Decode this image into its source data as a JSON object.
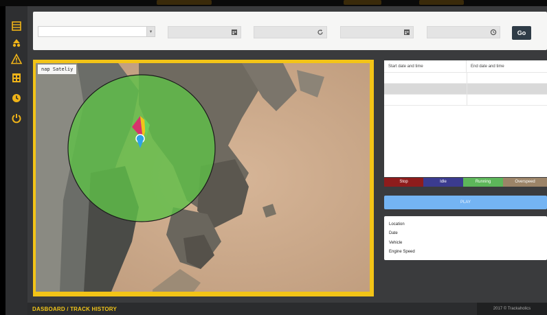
{
  "sidebar": {
    "items": [
      {
        "icon": "dashboard-grid-icon"
      },
      {
        "icon": "vehicles-icon"
      },
      {
        "icon": "alert-warning-icon"
      },
      {
        "icon": "report-calendar-icon"
      },
      {
        "icon": "history-icon"
      },
      {
        "icon": "power-logout-icon"
      }
    ]
  },
  "toolbar": {
    "vehicle_select_value": "",
    "fields": [
      {
        "icon": "calendar-icon",
        "value": ""
      },
      {
        "icon": "refresh-icon",
        "value": ""
      },
      {
        "icon": "calendar-icon",
        "value": ""
      },
      {
        "icon": "clock-icon",
        "value": ""
      }
    ],
    "go_label": "Go"
  },
  "map": {
    "label": "nap  Sateliy",
    "geofence_color": "#5fbf48",
    "marker_icon": "location-pin-icon"
  },
  "table": {
    "headers": [
      "Start date and time",
      "End date and time"
    ],
    "rows": [
      [
        "",
        ""
      ],
      [
        "",
        ""
      ],
      [
        "",
        ""
      ]
    ]
  },
  "legend": [
    {
      "label": "Stop",
      "color": "#8e1c1c"
    },
    {
      "label": "Idle",
      "color": "#3b3b8f"
    },
    {
      "label": "Running",
      "color": "#5db65a"
    },
    {
      "label": "Overspeed",
      "color": "#9c8468"
    }
  ],
  "play_label": "PLAY",
  "info": {
    "labels": [
      "Location",
      "Date",
      "Vehicle",
      "Engine Speed"
    ]
  },
  "footer": {
    "breadcrumb": "DASBOARD / TRACK HISTORY",
    "copyright": "2017 © Trackaholics"
  }
}
